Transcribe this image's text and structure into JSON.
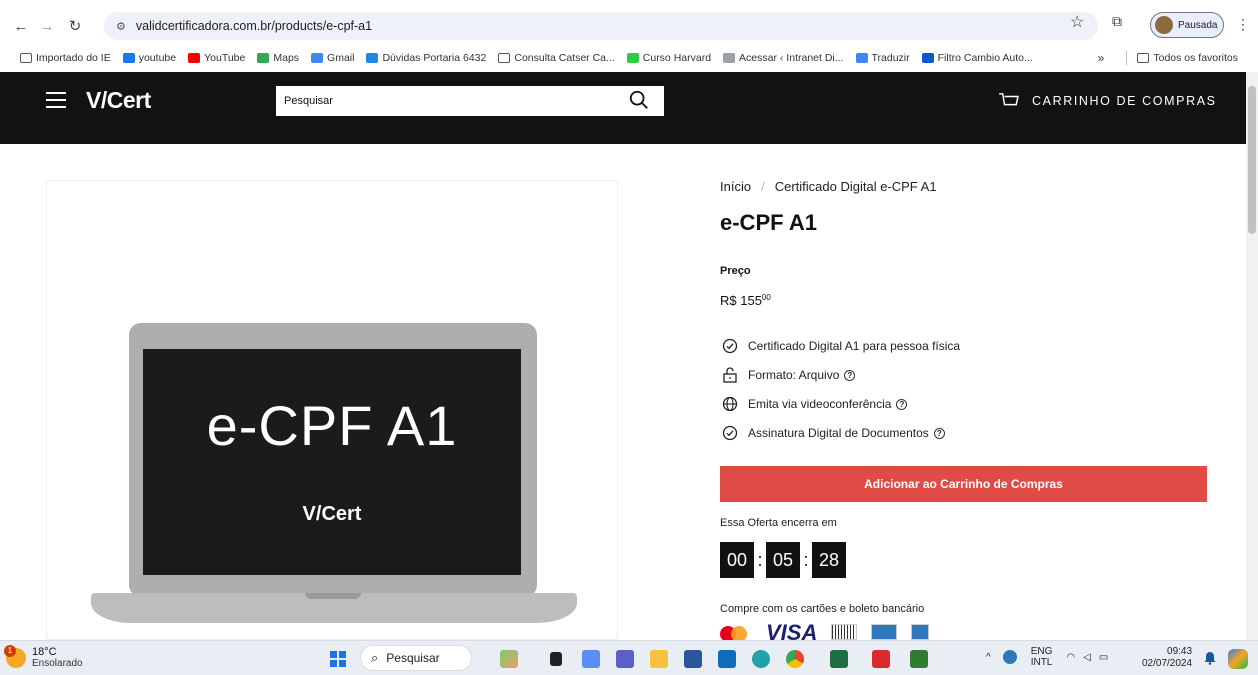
{
  "browser": {
    "url": "validcertificadora.com.br/products/e-cpf-a1",
    "profile_label": "Pausada",
    "bookmarks": [
      {
        "label": "Importado do IE",
        "color": ""
      },
      {
        "label": "youtube",
        "color": "#1877f2"
      },
      {
        "label": "YouTube",
        "color": "#ff0000"
      },
      {
        "label": "Maps",
        "color": "#34a853"
      },
      {
        "label": "Gmail",
        "color": "#4285f4"
      },
      {
        "label": "Dúvidas Portaria 6432",
        "color": "#1e88e5"
      },
      {
        "label": "Consulta Catser Ca...",
        "color": ""
      },
      {
        "label": "Curso Harvard",
        "color": "#2ecc40"
      },
      {
        "label": "Acessar ‹ Intranet Di...",
        "color": "#9aa0a6"
      },
      {
        "label": "Traduzir",
        "color": "#4285f4"
      },
      {
        "label": "Filtro Cambio Auto...",
        "color": "#0b57d0"
      }
    ],
    "bookmarks_overflow": "»",
    "all_bookmarks": "Todos os favoritos"
  },
  "header": {
    "logo": "V/Cert",
    "search_placeholder": "Pesquisar",
    "cart_label": "CARRINHO DE COMPRAS"
  },
  "product_image": {
    "screen_title": "e-CPF A1",
    "screen_logo": "V/Cert"
  },
  "product": {
    "breadcrumb_home": "Início",
    "breadcrumb_separator": "/",
    "breadcrumb_current": "Certificado Digital e-CPF A1",
    "title": "e-CPF A1",
    "price_label": "Preço",
    "price_main": "R$ 155",
    "price_cents": "00",
    "features": [
      {
        "icon": "check-circle-icon",
        "label": "Certificado Digital A1 para pessoa física",
        "help": false
      },
      {
        "icon": "lock-icon",
        "label": "Formato: Arquivo",
        "help": true
      },
      {
        "icon": "globe-icon",
        "label": "Emita via videoconferência",
        "help": true
      },
      {
        "icon": "check-circle-icon",
        "label": "Assinatura Digital de Documentos",
        "help": true
      }
    ],
    "help_glyph": "?",
    "add_to_cart": "Adicionar ao Carrinho de Compras",
    "offer_label": "Essa Oferta encerra em",
    "timer": {
      "hours": "00",
      "minutes": "05",
      "seconds": "28"
    },
    "timer_separator": ":",
    "payment_label": "Compre com os cartões e boleto bancário",
    "visa_label": "VISA"
  },
  "colors": {
    "header_bg": "#121212",
    "add_button": "#e04b45"
  },
  "taskbar": {
    "weather_temp": "18°C",
    "weather_status": "Ensolarado",
    "weather_badge": "1",
    "search": "Pesquisar",
    "lang_top": "ENG",
    "lang_bottom": "INTL",
    "time": "09:43",
    "date": "02/07/2024"
  }
}
